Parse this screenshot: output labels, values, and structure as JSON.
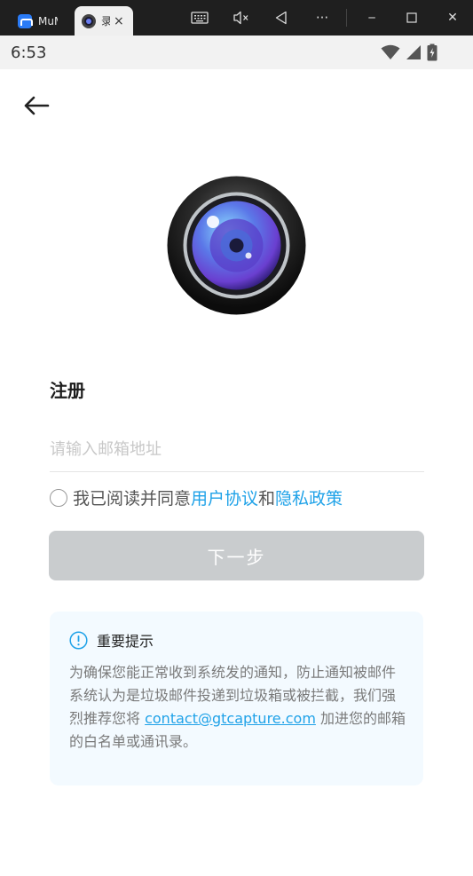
{
  "titlebar": {
    "tab1_label": "MuMu",
    "tab2_label": "录",
    "tab2_close": "×",
    "icons": [
      "keyboard-icon",
      "mute-icon",
      "back-triangle-icon",
      "more-icon",
      "minimize-icon",
      "maximize-icon",
      "close-icon"
    ],
    "more_glyph": "···",
    "minimize_glyph": "─",
    "close_glyph": "✕"
  },
  "statusbar": {
    "time": "6:53",
    "icons": [
      "wifi-icon",
      "signal-icon",
      "battery-charging-icon"
    ]
  },
  "app": {
    "title": "注册",
    "email_placeholder": "请输入邮箱地址",
    "email_value": "",
    "agreement_prefix": "我已阅读并同意",
    "user_agreement": "用户协议",
    "agreement_and": "和",
    "privacy_policy": "隐私政策",
    "agreement_checked": false,
    "next_button": "下一步",
    "notice": {
      "title": "重要提示",
      "body_before": "为确保您能正常收到系统发的通知，防止通知被邮件系统认为是垃圾邮件投递到垃圾箱或被拦截，我们强烈推荐您将 ",
      "email": "contact@gtcapture.com",
      "body_after": " 加进您的邮箱的白名单或通讯录。"
    }
  },
  "colors": {
    "accent": "#1fa2e8",
    "button_disabled": "#c9ccce",
    "notice_bg": "#f3faff",
    "titlebar_bg": "#1f1f1f"
  }
}
